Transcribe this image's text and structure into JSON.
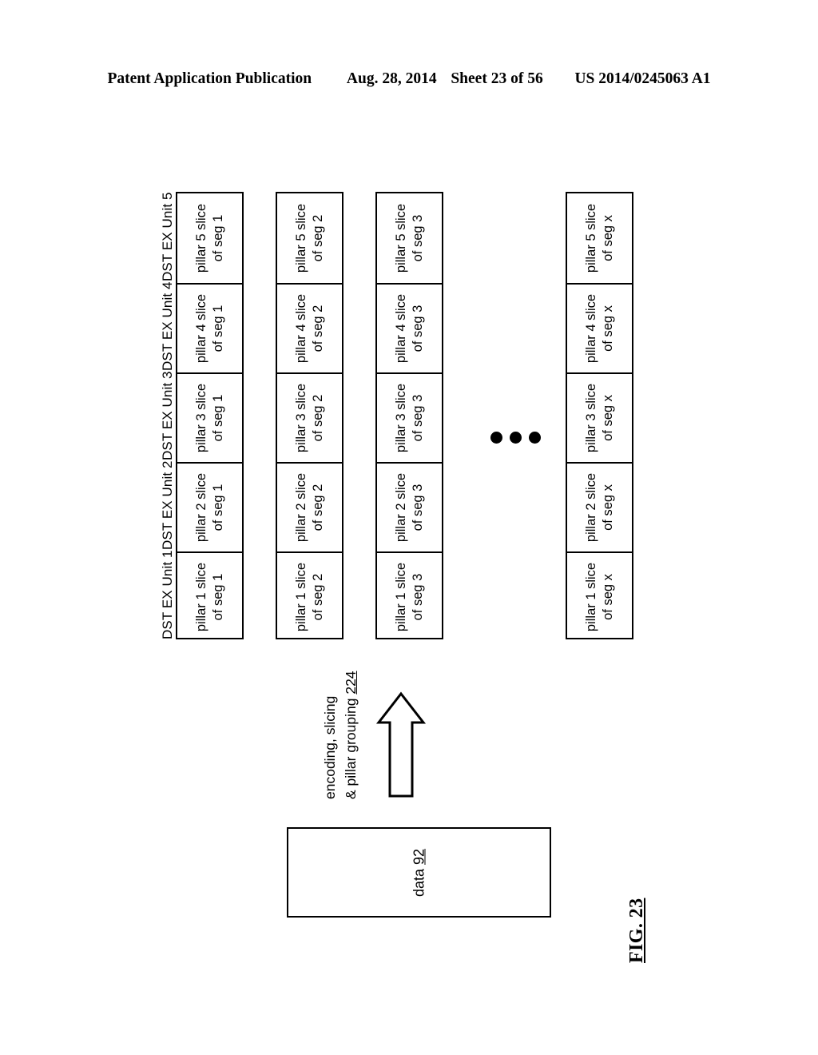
{
  "header": {
    "publication": "Patent Application Publication",
    "date": "Aug. 28, 2014",
    "sheet": "Sheet 23 of 56",
    "patent_number": "US 2014/0245063 A1"
  },
  "figure": {
    "number": "FIG. 23",
    "unit_labels": [
      "DST EX Unit 1",
      "DST EX Unit 2",
      "DST EX Unit 3",
      "DST EX Unit 4",
      "DST EX Unit 5"
    ],
    "segments": [
      {
        "id": "seg-1",
        "cells": [
          {
            "line1": "pillar 1 slice",
            "line2": "of seg 1"
          },
          {
            "line1": "pillar 2 slice",
            "line2": "of seg 1"
          },
          {
            "line1": "pillar 3 slice",
            "line2": "of seg 1"
          },
          {
            "line1": "pillar 4 slice",
            "line2": "of seg 1"
          },
          {
            "line1": "pillar 5 slice",
            "line2": "of seg 1"
          }
        ]
      },
      {
        "id": "seg-2",
        "cells": [
          {
            "line1": "pillar 1 slice",
            "line2": "of seg 2"
          },
          {
            "line1": "pillar 2 slice",
            "line2": "of seg 2"
          },
          {
            "line1": "pillar 3 slice",
            "line2": "of seg 2"
          },
          {
            "line1": "pillar 4 slice",
            "line2": "of seg 2"
          },
          {
            "line1": "pillar 5 slice",
            "line2": "of seg 2"
          }
        ]
      },
      {
        "id": "seg-3",
        "cells": [
          {
            "line1": "pillar 1 slice",
            "line2": "of seg 3"
          },
          {
            "line1": "pillar 2 slice",
            "line2": "of seg 3"
          },
          {
            "line1": "pillar 3 slice",
            "line2": "of seg 3"
          },
          {
            "line1": "pillar 4 slice",
            "line2": "of seg 3"
          },
          {
            "line1": "pillar 5 slice",
            "line2": "of seg 3"
          }
        ]
      },
      {
        "id": "seg-x",
        "cells": [
          {
            "line1": "pillar 1 slice",
            "line2": "of seg x"
          },
          {
            "line1": "pillar 2 slice",
            "line2": "of seg x"
          },
          {
            "line1": "pillar 3 slice",
            "line2": "of seg x"
          },
          {
            "line1": "pillar 4 slice",
            "line2": "of seg x"
          },
          {
            "line1": "pillar 5 slice",
            "line2": "of seg x"
          }
        ]
      }
    ],
    "ellipsis": "• • •",
    "process": {
      "line1": "encoding, slicing",
      "line2": "& pillar grouping",
      "reference": "224"
    },
    "data_block": {
      "label": "data",
      "reference": "92"
    }
  },
  "colors": {
    "ink": "#000000",
    "paper": "#ffffff"
  }
}
